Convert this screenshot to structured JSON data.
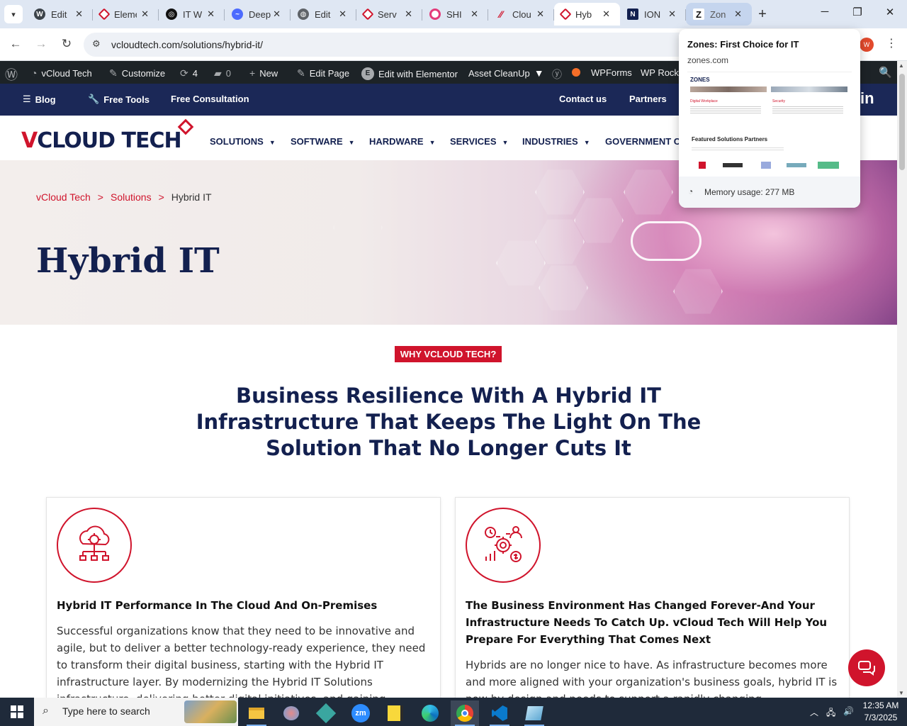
{
  "browser": {
    "tabs": [
      {
        "title": "Edit",
        "favicon": "wordpress-icon",
        "color": "#3c434a"
      },
      {
        "title": "Elementor",
        "favicon": "vcloud-diamond-icon",
        "color": "#d0142c"
      },
      {
        "title": "IT W",
        "favicon": "openai-icon",
        "color": "#111111"
      },
      {
        "title": "Deep",
        "favicon": "deepseek-icon",
        "color": "#4d6bfe"
      },
      {
        "title": "Edit",
        "favicon": "globe-icon",
        "color": "#5f6368"
      },
      {
        "title": "Serv",
        "favicon": "vcloud-diamond-icon",
        "color": "#d0142c"
      },
      {
        "title": "SHI",
        "favicon": "shi-ring-icon",
        "color": "#e33b7a"
      },
      {
        "title": "Clou",
        "favicon": "cloud-slash-icon",
        "color": "#d0142c"
      },
      {
        "title": "Hyb",
        "favicon": "vcloud-diamond-icon",
        "color": "#d0142c"
      },
      {
        "title": "ION",
        "favicon": "ion-icon",
        "color": "#13204f"
      },
      {
        "title": "Zon",
        "favicon": "zones-z-icon",
        "color": "#111111"
      }
    ],
    "active_tab_index": 8,
    "hover_tab_index": 10,
    "url": "vcloudtech.com/solutions/hybrid-it/",
    "profile_initial": "W"
  },
  "hover_card": {
    "title": "Zones: First Choice for IT",
    "domain": "zones.com",
    "thumb_logo": "ZONES",
    "thumb_card1": "Digital Workplace",
    "thumb_card2": "Security",
    "thumb_partners_title": "Featured Solutions Partners",
    "memory": "Memory usage: 277 MB"
  },
  "wp_admin_bar": {
    "site": "vCloud Tech",
    "customize": "Customize",
    "updates": "4",
    "comments": "0",
    "new": "New",
    "edit_page": "Edit Page",
    "elementor": "Edit with Elementor",
    "asset_cleanup": "Asset CleanUp",
    "wpforms": "WPForms",
    "wp_rocket": "WP Rocke"
  },
  "top_nav": {
    "blog": "Blog",
    "free_tools": "Free Tools",
    "consultation": "Free Consultation",
    "contact": "Contact us",
    "partners": "Partners",
    "linkedin": "in"
  },
  "header": {
    "logo_v": "V",
    "logo_rest": "CLOUD TECH",
    "menu": [
      "SOLUTIONS",
      "SOFTWARE",
      "HARDWARE",
      "SERVICES",
      "INDUSTRIES",
      "GOVERNMENT C"
    ]
  },
  "hero": {
    "crumbs": [
      "vCloud Tech",
      "Solutions",
      "Hybrid IT"
    ],
    "crumb_sep": ">",
    "title": "Hybrid IT"
  },
  "content": {
    "badge": "WHY VCLOUD TECH?",
    "heading_lines": [
      "Business Resilience With A Hybrid IT",
      "Infrastructure That Keeps The Light On The",
      "Solution That No Longer Cuts It"
    ],
    "cards": [
      {
        "title": "Hybrid IT Performance In The Cloud And On-Premises",
        "text": "Successful organizations know that they need to be innovative and agile, but to deliver a better technology-ready experience, they need to transform their digital business, starting with the Hybrid IT infrastructure layer.  By modernizing the Hybrid IT Solutions infrastructure, delivering better digital initiatives, and gaining"
      },
      {
        "title": "The Business Environment Has Changed Forever-And Your Infrastructure Needs To Catch Up. vCloud Tech Will Help You Prepare For Everything That Comes Next",
        "text": "Hybrids are no longer nice to have. As infrastructure becomes more and more aligned with your organization's business goals, hybrid IT is now by design and needs to support a rapidly changing"
      }
    ]
  },
  "taskbar": {
    "search_placeholder": "Type here to search",
    "time": "12:35 AM",
    "date": "7/3/2025"
  },
  "colors": {
    "brand_red": "#d0142c",
    "brand_navy": "#13204f",
    "topnav_bg": "#1b2857",
    "wpbar_bg": "#1d2327"
  }
}
